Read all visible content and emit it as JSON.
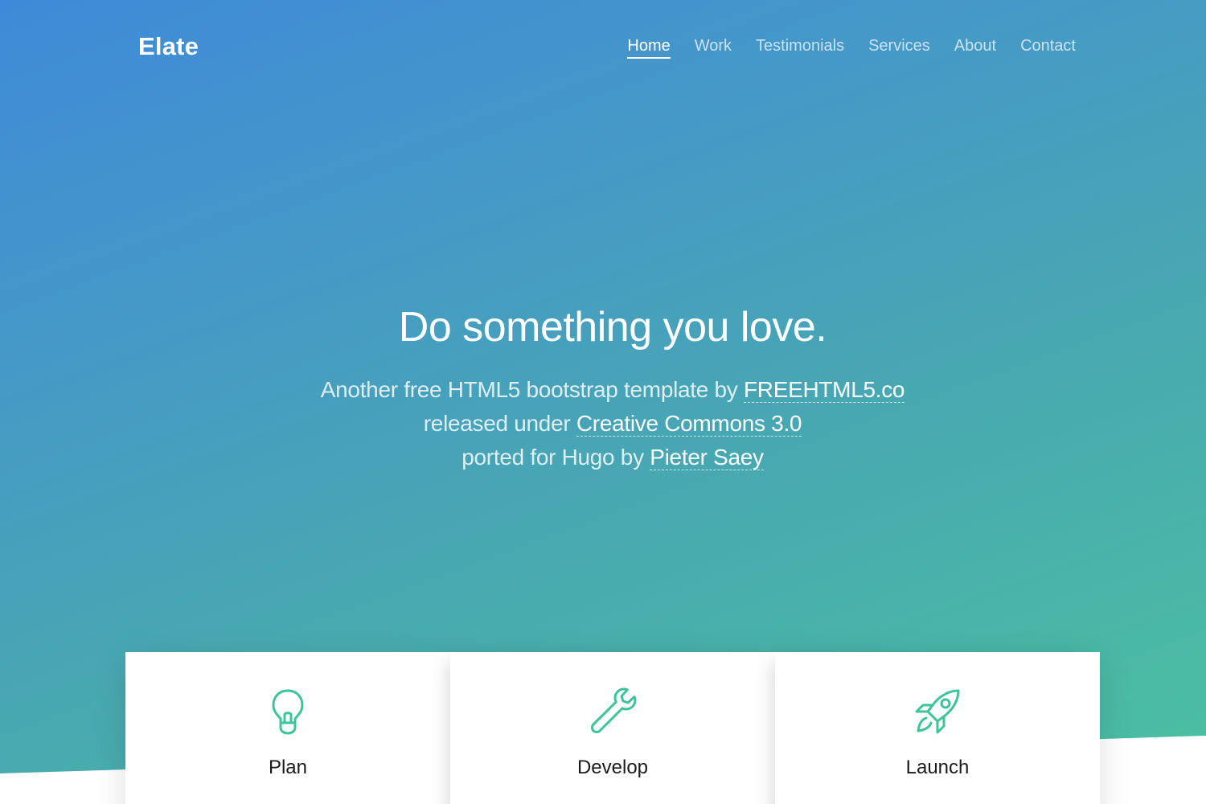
{
  "brand": "Elate",
  "nav": {
    "items": [
      "Home",
      "Work",
      "Testimonials",
      "Services",
      "About",
      "Contact"
    ],
    "active": "Home"
  },
  "hero": {
    "title": "Do something you love.",
    "line1_text": "Another free HTML5 bootstrap template by ",
    "line1_link": "FREEHTML5.co",
    "line2_text": "released under ",
    "line2_link": "Creative Commons 3.0",
    "line3_text": "ported for Hugo by ",
    "line3_link": "Pieter Saey"
  },
  "features": [
    {
      "label": "Plan",
      "icon": "lightbulb-icon"
    },
    {
      "label": "Develop",
      "icon": "wrench-icon"
    },
    {
      "label": "Launch",
      "icon": "rocket-icon"
    }
  ],
  "colors": {
    "gradient_start": "#3f8ad8",
    "gradient_end": "#4cc1a0",
    "icon_accent": "#3cc49a",
    "text_light": "#ffffff",
    "card_bg": "#ffffff"
  }
}
